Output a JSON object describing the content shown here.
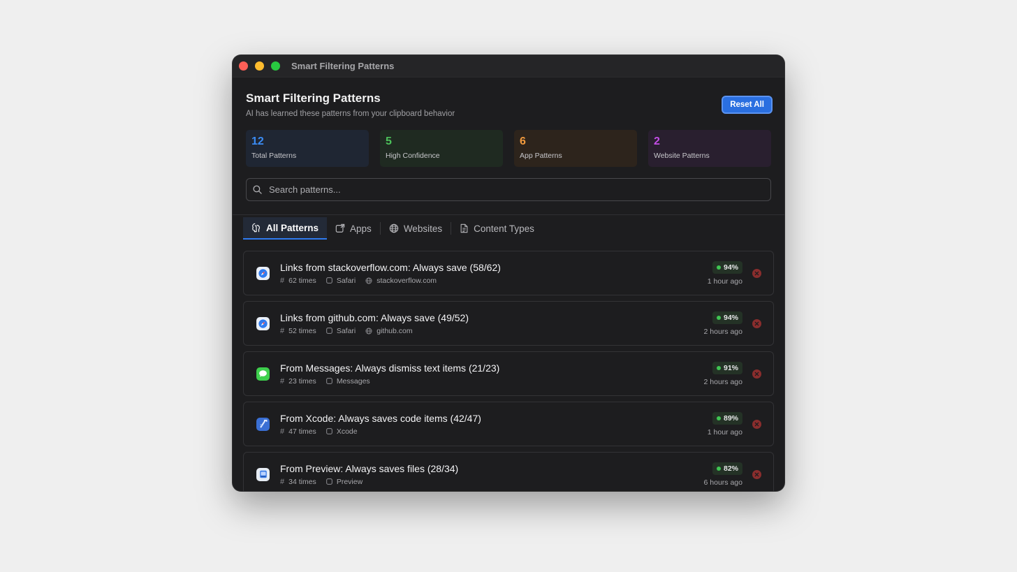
{
  "window": {
    "title": "Smart Filtering Patterns"
  },
  "header": {
    "title": "Smart Filtering Patterns",
    "subtitle": "AI has learned these patterns from your clipboard behavior",
    "reset_label": "Reset All"
  },
  "stats": [
    {
      "value": "12",
      "label": "Total Patterns",
      "color": "#3b8cf5"
    },
    {
      "value": "5",
      "label": "High Confidence",
      "color": "#4cc25a"
    },
    {
      "value": "6",
      "label": "App Patterns",
      "color": "#f19a3e"
    },
    {
      "value": "2",
      "label": "Website Patterns",
      "color": "#c34de6"
    }
  ],
  "search": {
    "placeholder": "Search patterns...",
    "value": ""
  },
  "tabs": [
    {
      "label": "All Patterns",
      "icon": "brain-icon",
      "active": true
    },
    {
      "label": "Apps",
      "icon": "app-window-icon",
      "active": false
    },
    {
      "label": "Websites",
      "icon": "globe-icon",
      "active": false
    },
    {
      "label": "Content Types",
      "icon": "document-icon",
      "active": false
    }
  ],
  "patterns": [
    {
      "title": "Links from stackoverflow.com: Always save (58/62)",
      "count": "62 times",
      "app": "Safari",
      "site": "stackoverflow.com",
      "confidence": "94%",
      "time": "1 hour ago",
      "icon": "safari-icon"
    },
    {
      "title": "Links from github.com: Always save (49/52)",
      "count": "52 times",
      "app": "Safari",
      "site": "github.com",
      "confidence": "94%",
      "time": "2 hours ago",
      "icon": "safari-icon"
    },
    {
      "title": "From Messages: Always dismiss text items (21/23)",
      "count": "23 times",
      "app": "Messages",
      "site": "",
      "confidence": "91%",
      "time": "2 hours ago",
      "icon": "messages-icon"
    },
    {
      "title": "From Xcode: Always saves code items (42/47)",
      "count": "47 times",
      "app": "Xcode",
      "site": "",
      "confidence": "89%",
      "time": "1 hour ago",
      "icon": "xcode-icon"
    },
    {
      "title": "From Preview: Always saves files (28/34)",
      "count": "34 times",
      "app": "Preview",
      "site": "",
      "confidence": "82%",
      "time": "6 hours ago",
      "icon": "preview-icon"
    }
  ],
  "colors": {
    "accent": "#2a6fe0",
    "confidence": "#3fc552",
    "delete": "#8a2d2d"
  }
}
